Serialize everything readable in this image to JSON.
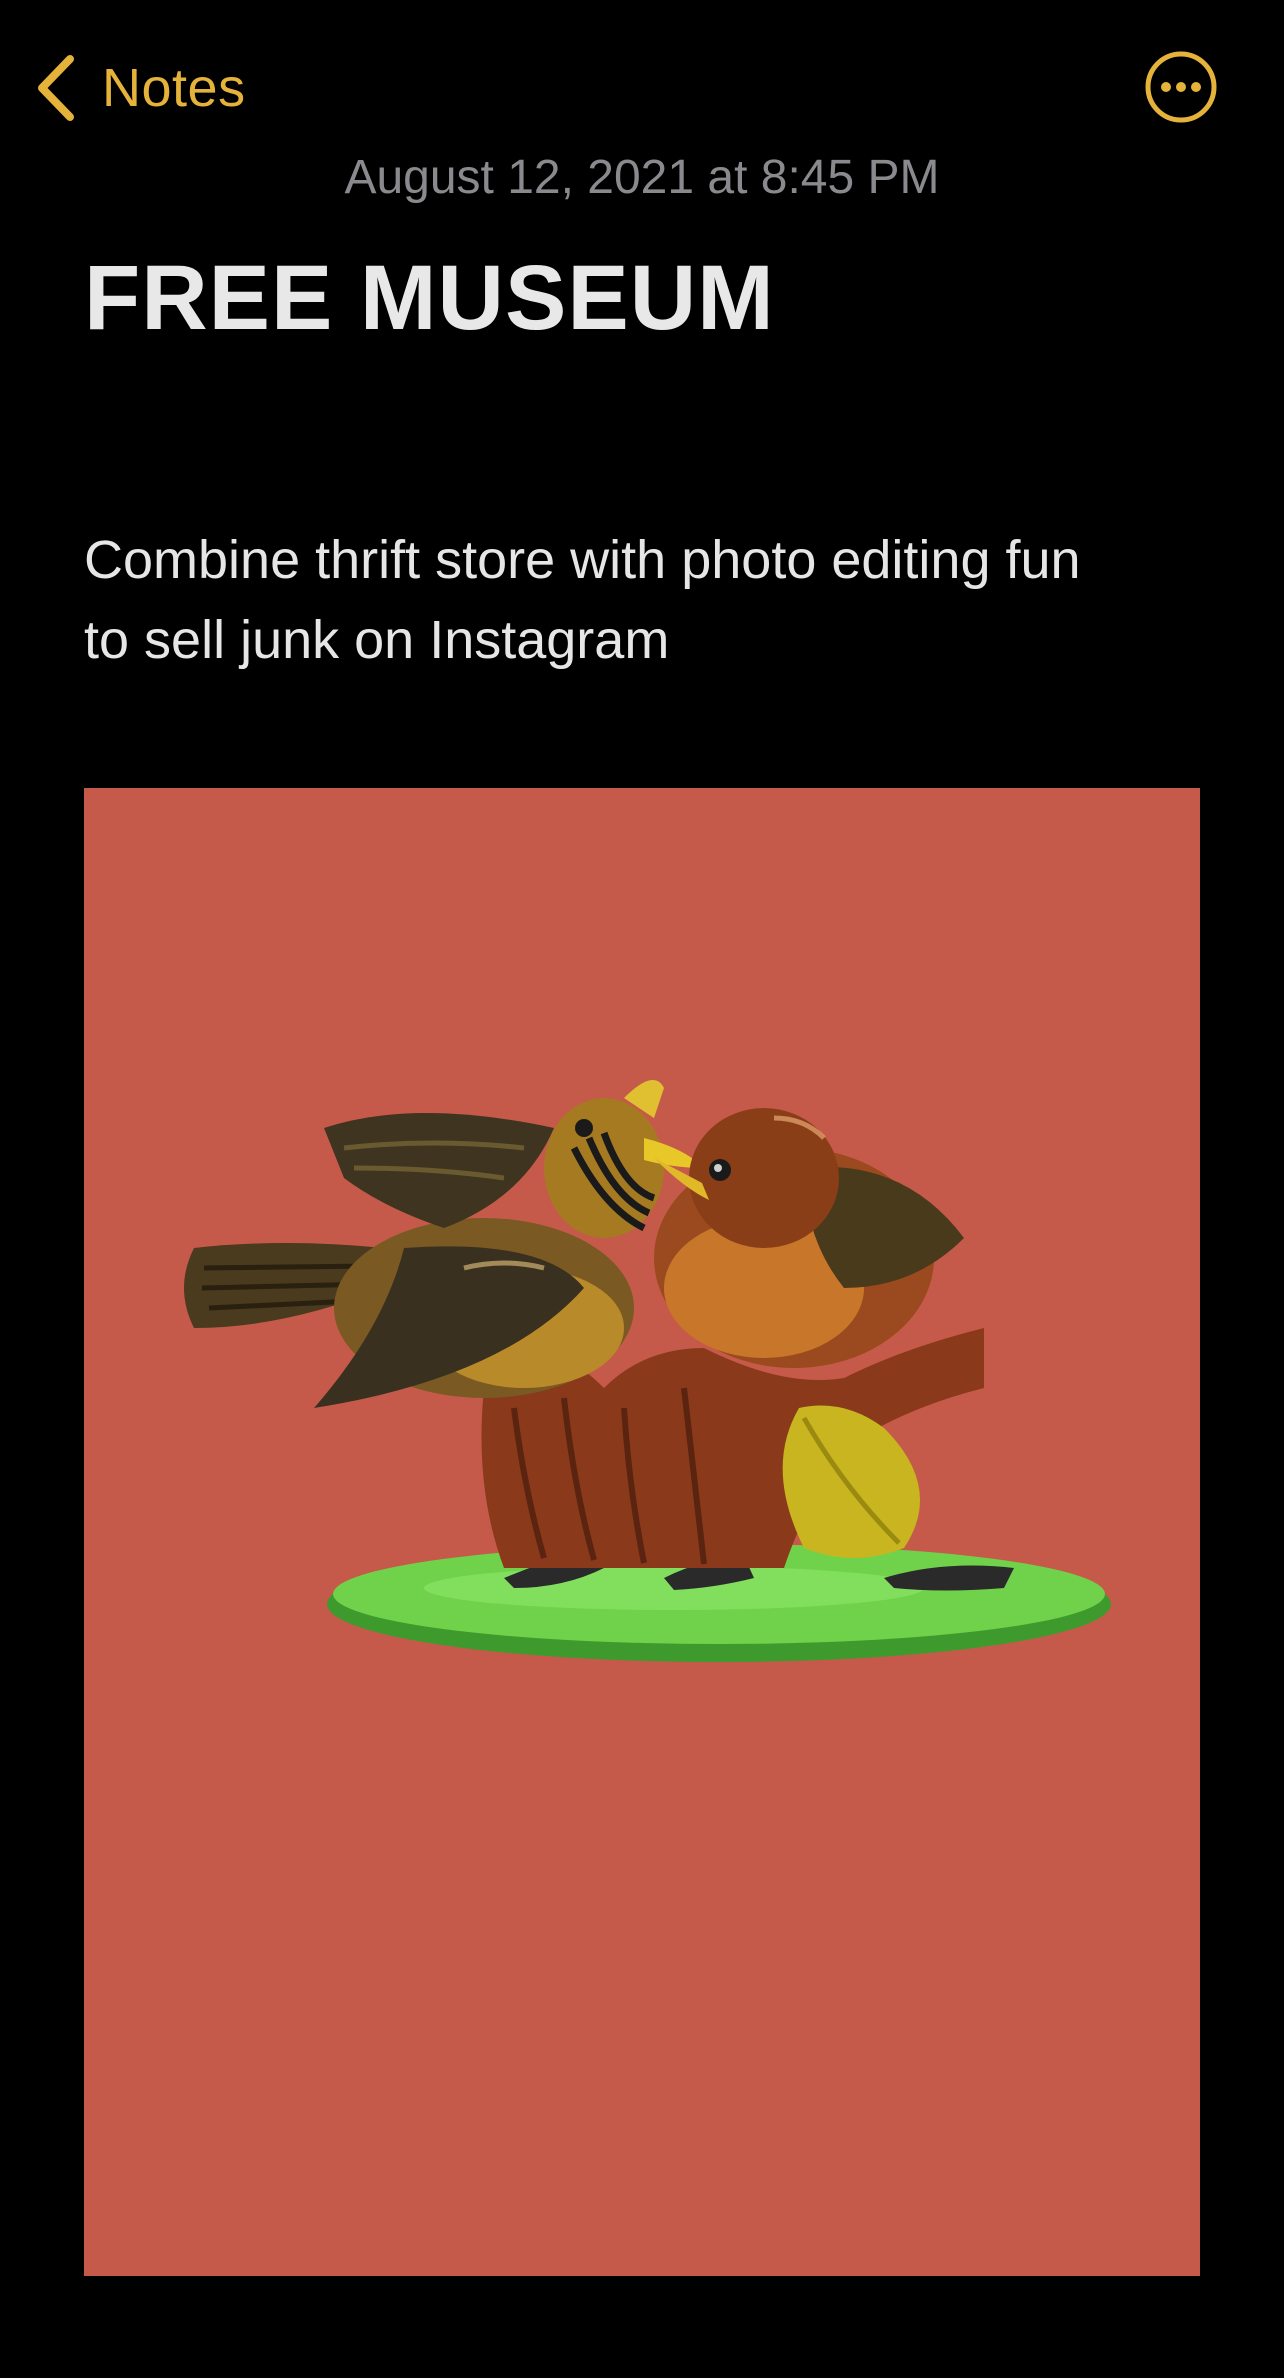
{
  "nav": {
    "back_label": "Notes",
    "back_icon": "chevron-left-icon",
    "more_icon": "ellipsis-circle-icon",
    "accent_color": "#e6b33a"
  },
  "note": {
    "date": "August 12, 2021 at 8:45 PM",
    "title": "FREE MUSEUM",
    "body_lines": [
      "Combine thrift store with photo editing fun",
      "to sell junk on Instagram"
    ]
  },
  "attachment": {
    "background_color": "#c65a4a",
    "subject": "ceramic-birds-figurine-image"
  }
}
